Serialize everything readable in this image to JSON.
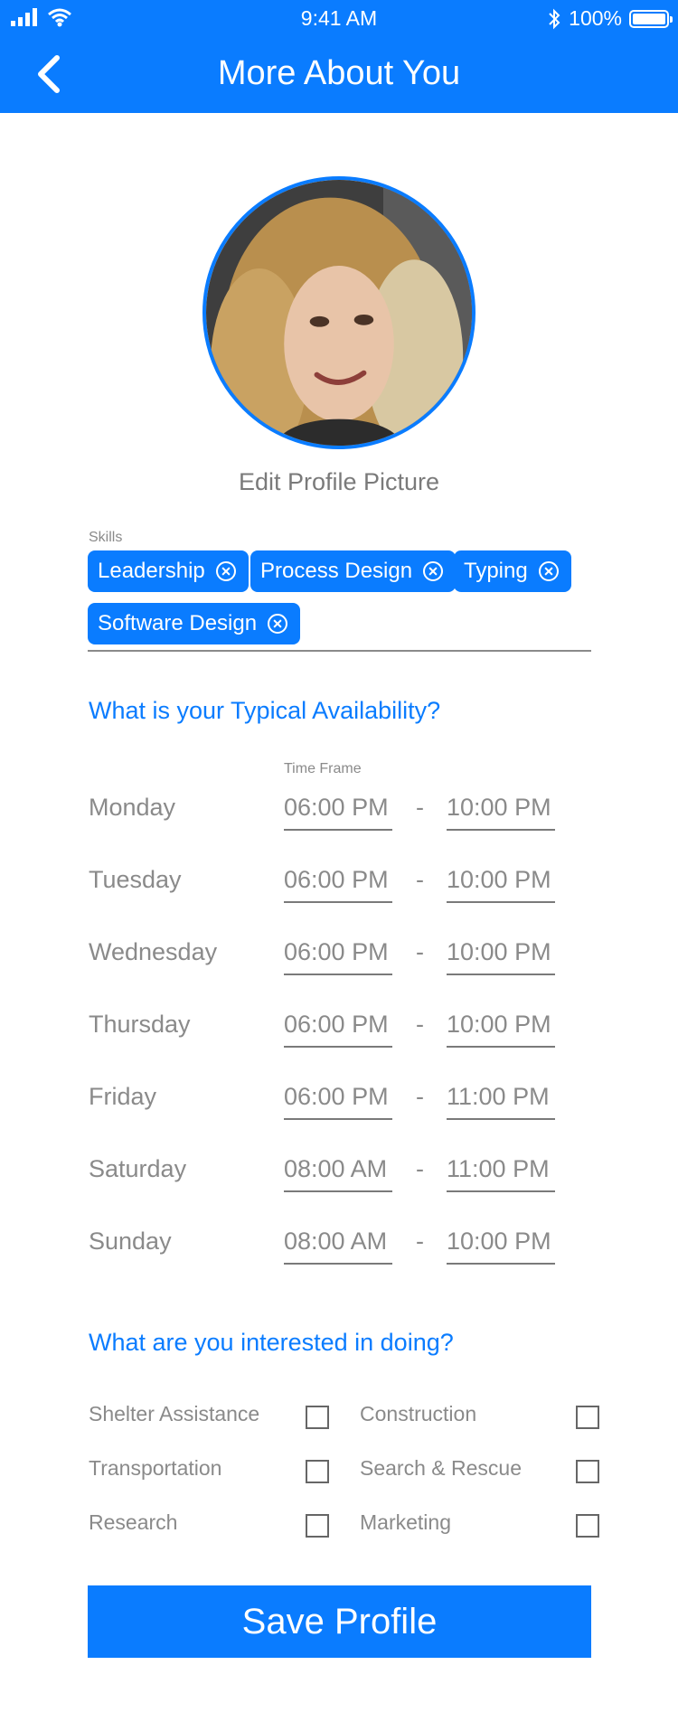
{
  "status_bar": {
    "time": "9:41 AM",
    "battery": "100%"
  },
  "header": {
    "title": "More About You"
  },
  "profile": {
    "edit_picture_label": "Edit Profile Picture"
  },
  "skills": {
    "label": "Skills",
    "items": [
      "Leadership",
      "Process Design",
      "Typing",
      "Software Design"
    ]
  },
  "availability": {
    "heading": "What is your Typical Availability?",
    "time_frame_label": "Time Frame",
    "separator": "-",
    "days": [
      {
        "day": "Monday",
        "from": "06:00 PM",
        "to": "10:00 PM"
      },
      {
        "day": "Tuesday",
        "from": "06:00 PM",
        "to": "10:00 PM"
      },
      {
        "day": "Wednesday",
        "from": "06:00 PM",
        "to": "10:00 PM"
      },
      {
        "day": "Thursday",
        "from": "06:00 PM",
        "to": "10:00 PM"
      },
      {
        "day": "Friday",
        "from": "06:00 PM",
        "to": "11:00 PM"
      },
      {
        "day": "Saturday",
        "from": "08:00 AM",
        "to": "11:00 PM"
      },
      {
        "day": "Sunday",
        "from": "08:00 AM",
        "to": "10:00 PM"
      }
    ]
  },
  "interests": {
    "heading": "What are you interested in doing?",
    "options": [
      {
        "label": "Shelter Assistance",
        "checked": false
      },
      {
        "label": "Construction",
        "checked": false
      },
      {
        "label": "Transportation",
        "checked": false
      },
      {
        "label": "Search & Rescue",
        "checked": false
      },
      {
        "label": "Research",
        "checked": false
      },
      {
        "label": "Marketing",
        "checked": false
      }
    ]
  },
  "save_button": {
    "label": "Save Profile"
  },
  "colors": {
    "accent": "#0a7cff",
    "text_muted": "#8a8a8a",
    "background": "#ffffff"
  }
}
